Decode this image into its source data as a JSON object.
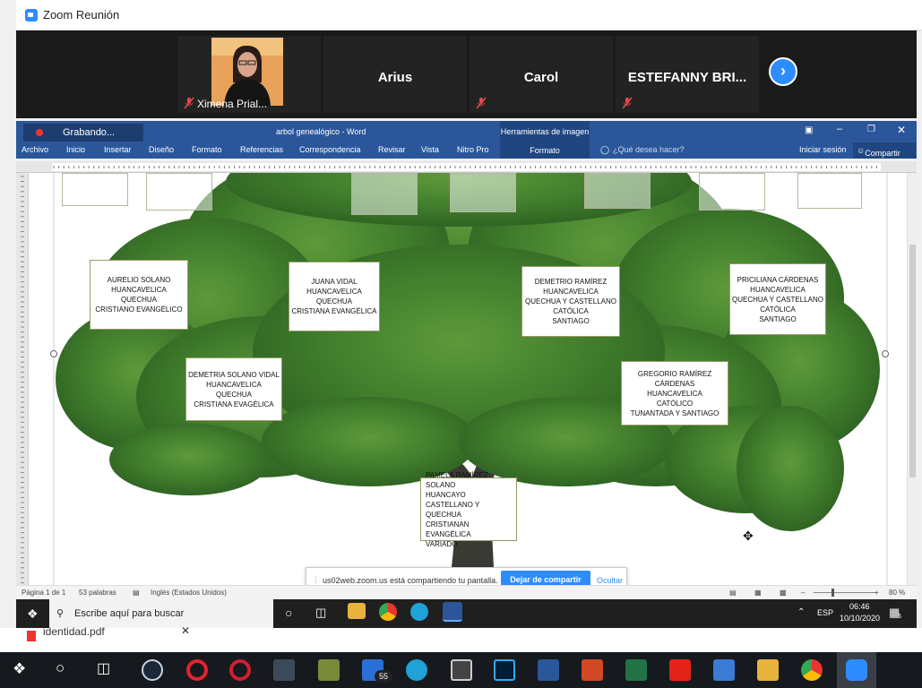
{
  "zoom": {
    "title": "Zoom Reunión",
    "participants": [
      {
        "name": "Ximena Prial..."
      },
      {
        "name": "Arius"
      },
      {
        "name": "Carol"
      },
      {
        "name": "ESTEFANNY BRI..."
      }
    ],
    "recording": "Grabando...",
    "share_notice": "us02web.zoom.us está compartiendo tu pantalla.",
    "stop_share": "Dejar de compartir",
    "hide": "Ocultar"
  },
  "word": {
    "doc_title": "arbol genealógico - Word",
    "image_tools": "Herramientas de imagen",
    "tabs": [
      "Archivo",
      "Inicio",
      "Insertar",
      "Diseño",
      "Formato",
      "Referencias",
      "Correspondencia",
      "Revisar",
      "Vista",
      "Nitro Pro",
      "Formato"
    ],
    "tell_me": "¿Qué desea hacer?",
    "sign_in": "Iniciar sesión",
    "share": "Compartir",
    "status": {
      "page": "Página 1 de 1",
      "words": "53 palabras",
      "lang": "Inglés (Estados Unidos)",
      "zoom": "80 %"
    }
  },
  "cards": [
    {
      "lines": [
        "AURELIO SOLANO",
        "HUANCAVELICA",
        "QUECHUA",
        "CRISTIANO EVANGÉLICO"
      ]
    },
    {
      "lines": [
        "JUANA VIDAL",
        "HUANCAVELICA",
        "QUECHUA",
        "CRISTIANA EVANGÉLICA"
      ]
    },
    {
      "lines": [
        "DEMETRIO RAMÍREZ",
        "HUANCAVELICA",
        "QUECHUA Y CASTELLANO",
        "CATÓLICA",
        "SANTIAGO"
      ]
    },
    {
      "lines": [
        "PRICILIANA CÁRDENAS",
        "HUANCAVELICA",
        "QUECHUA Y CASTELLANO",
        "CATÓLICA",
        "SANTIAGO"
      ]
    },
    {
      "lines": [
        "DEMETRIA SOLANO VIDAL",
        "HUANCAVELICA",
        "QUECHUA",
        "CRISTIANA EVAGÉLICA"
      ]
    },
    {
      "lines": [
        "GREGORIO RAMÍREZ CÁRDENAS",
        "HUANCAVELICA",
        "CATÓLICO",
        "TUNANTADA Y SANTIAGO"
      ]
    },
    {
      "lines": [
        "PAMELA RAMÍREZ SOLANO",
        "HUANCAYO",
        "CASTELLANO Y QUECHUA",
        "CRISTIANAN EVANGÉLICA",
        "VARIADO"
      ]
    }
  ],
  "taskbar": {
    "search": "Escribe aquí para buscar",
    "lang": "ESP",
    "time": "06:46",
    "date": "10/10/2020",
    "notif_count": "6",
    "mail_badge": "55"
  },
  "behind_file": "identidad.pdf",
  "colors": {
    "word_blue": "#2b579a",
    "zoom_blue": "#2d8cff"
  }
}
